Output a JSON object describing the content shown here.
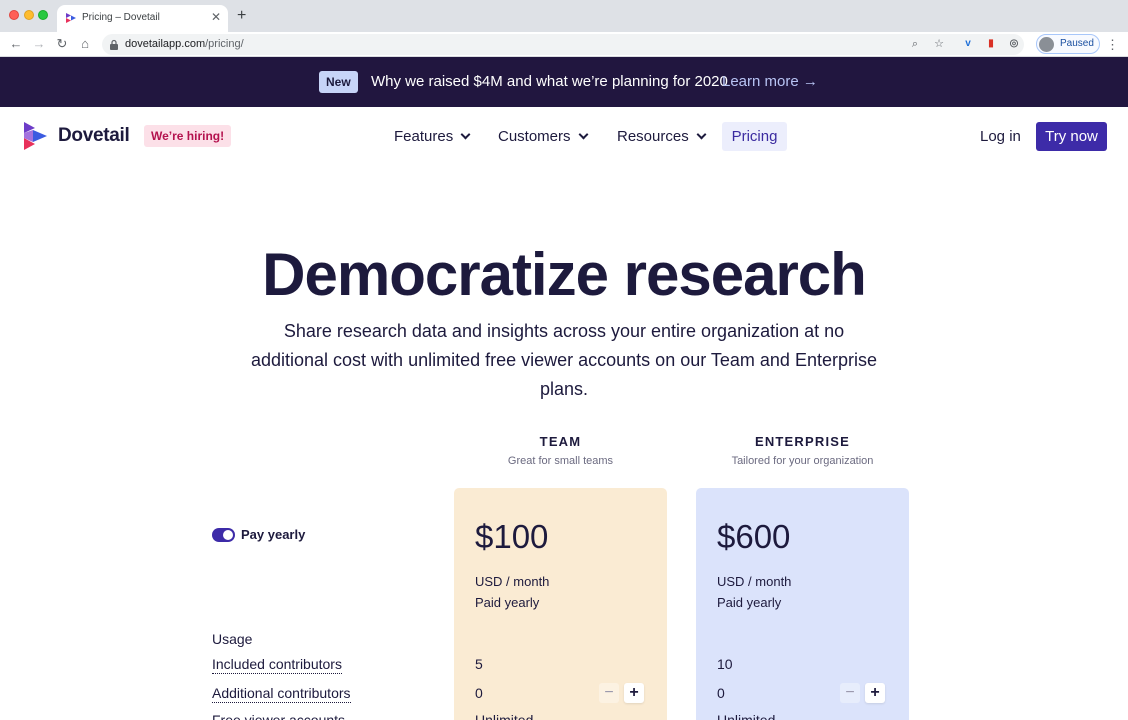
{
  "browser": {
    "tab_title": "Pricing – Dovetail",
    "url_domain": "dovetailapp.com",
    "url_path": "/pricing/",
    "profile_status": "Paused"
  },
  "banner": {
    "badge": "New",
    "text": "Why we raised $4M and what we’re planning for 2020",
    "link": "Learn more →"
  },
  "nav": {
    "brand": "Dovetail",
    "hiring_badge": "We’re hiring!",
    "items": [
      {
        "label": "Features"
      },
      {
        "label": "Customers"
      },
      {
        "label": "Resources"
      },
      {
        "label": "Pricing"
      }
    ],
    "login": "Log in",
    "cta": "Try now"
  },
  "hero": {
    "title": "Democratize research",
    "subtitle": "Share research data and insights across your entire organization at no additional cost with unlimited free viewer accounts on our Team and Enterprise plans."
  },
  "billing": {
    "toggle_label": "Pay yearly",
    "toggle_on": true
  },
  "plans": [
    {
      "name": "TEAM",
      "tagline": "Great for small teams",
      "price": "$100",
      "unit": "USD / month",
      "billing": "Paid yearly",
      "color": "#faebd3"
    },
    {
      "name": "ENTERPRISE",
      "tagline": "Tailored for your organization",
      "price": "$600",
      "unit": "USD / month",
      "billing": "Paid yearly",
      "color": "#dbe3fb"
    }
  ],
  "features": {
    "section_label": "Usage",
    "rows": [
      {
        "label": "Included contributors",
        "team": "5",
        "enterprise": "10"
      },
      {
        "label": "Additional contributors",
        "team": "0",
        "enterprise": "0",
        "stepper": true
      },
      {
        "label": "Free viewer accounts",
        "team": "Unlimited",
        "enterprise": "Unlimited"
      }
    ],
    "stepper_minus": "−",
    "stepper_plus": "+"
  },
  "colors": {
    "banner_bg": "#21163f",
    "accent": "#3d2ba8",
    "hiring_bg": "#fce0e8",
    "hiring_text": "#b4124e"
  }
}
